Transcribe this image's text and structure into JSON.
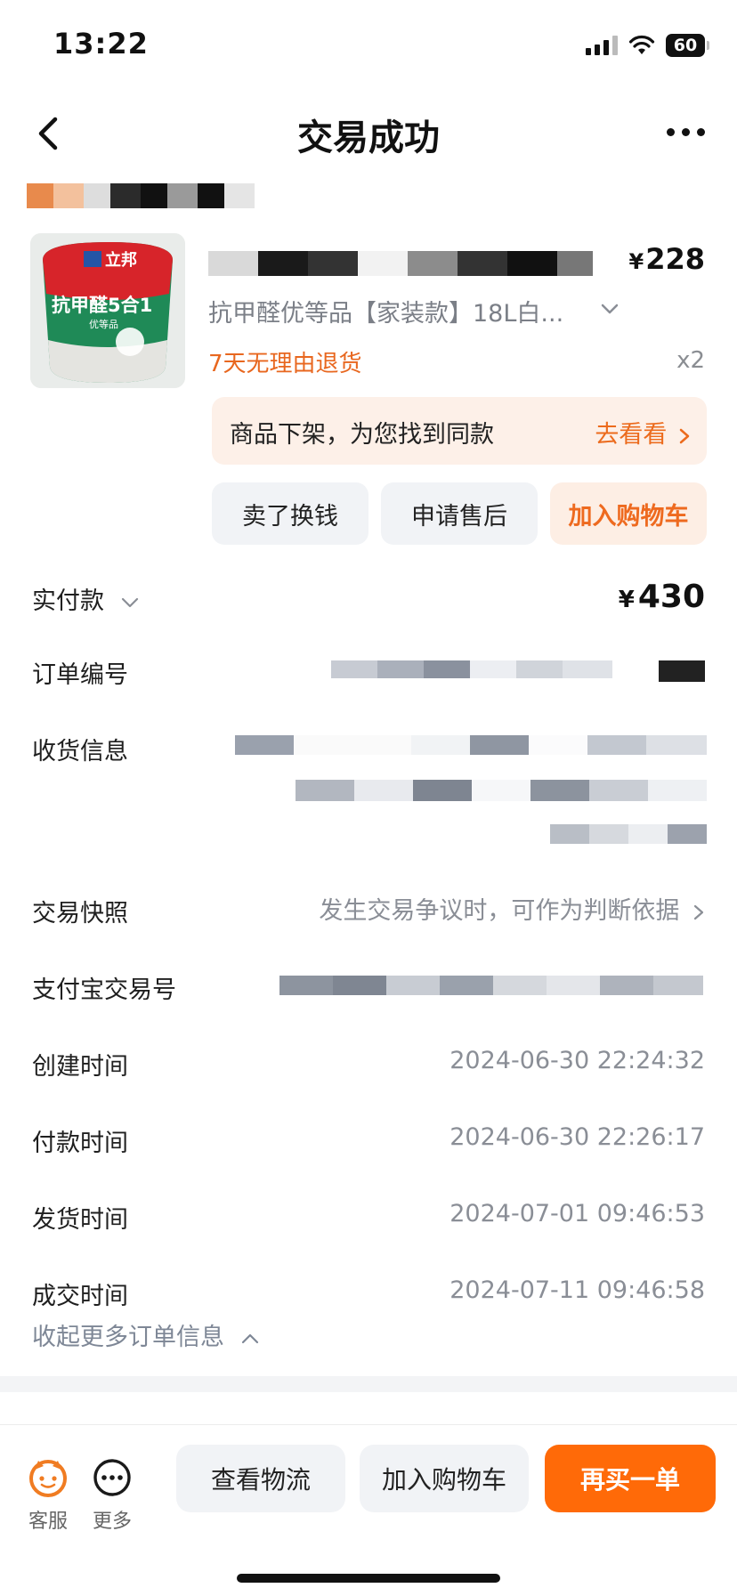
{
  "status_bar": {
    "time": "13:22",
    "battery": "60"
  },
  "nav": {
    "title": "交易成功"
  },
  "product": {
    "price_symbol": "¥",
    "price": "228",
    "sku": "抗甲醛优等品【家装款】18L白...",
    "return_policy": "7天无理由退货",
    "quantity": "x2",
    "image_brand": "立邦",
    "image_text": "抗甲醛5合1",
    "image_sub": "优等品"
  },
  "notice": {
    "text": "商品下架，为您找到同款",
    "link": "去看看"
  },
  "actions": {
    "sell": "卖了换钱",
    "after_sales": "申请售后",
    "add_cart": "加入购物车"
  },
  "order": {
    "paid_label": "实付款",
    "paid_symbol": "¥",
    "paid_amount": "430",
    "order_no_label": "订单编号",
    "shipping_label": "收货信息",
    "snapshot_label": "交易快照",
    "snapshot_value": "发生交易争议时，可作为判断依据",
    "alipay_label": "支付宝交易号",
    "created_label": "创建时间",
    "created_value": "2024-06-30 22:24:32",
    "paid_time_label": "付款时间",
    "paid_time_value": "2024-06-30 22:26:17",
    "shipped_label": "发货时间",
    "shipped_value": "2024-07-01 09:46:53",
    "completed_label": "成交时间",
    "completed_value": "2024-07-11 09:46:58",
    "collapse": "收起更多订单信息"
  },
  "bottom": {
    "service": "客服",
    "more": "更多",
    "logistics": "查看物流",
    "add_cart": "加入购物车",
    "rebuy": "再买一单"
  },
  "colors": {
    "accent": "#ff6a08",
    "accent_text": "#ec6b1d",
    "muted": "#8a8e96"
  }
}
